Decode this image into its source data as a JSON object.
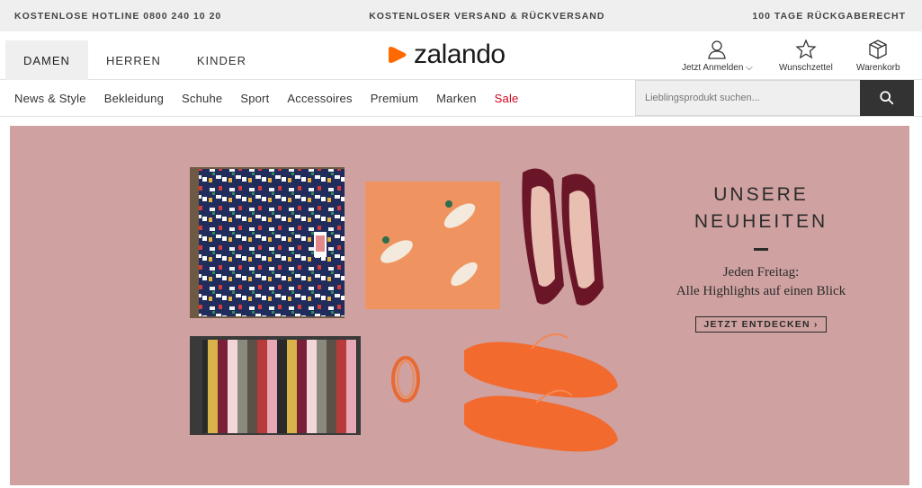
{
  "topbar": {
    "hotline": "KOSTENLOSE HOTLINE 0800 240 10 20",
    "shipping": "KOSTENLOSER VERSAND & RÜCKVERSAND",
    "returns": "100 TAGE RÜCKGABERECHT"
  },
  "header": {
    "tabs": [
      "DAMEN",
      "HERREN",
      "KINDER"
    ],
    "active_tab": "DAMEN",
    "logo": "zalando",
    "account": {
      "login": "Jetzt Anmelden",
      "wishlist": "Wunschzettel",
      "cart": "Warenkorb"
    }
  },
  "nav": {
    "items": [
      "News & Style",
      "Bekleidung",
      "Schuhe",
      "Sport",
      "Accessoires",
      "Premium",
      "Marken",
      "Sale"
    ]
  },
  "search": {
    "placeholder": "Lieblingsprodukt suchen..."
  },
  "hero": {
    "title_line1": "UNSERE",
    "title_line2": "NEUHEITEN",
    "subtitle_line1": "Jeden Freitag:",
    "subtitle_line2": "Alle Highlights auf einen Blick",
    "cta": "JETZT ENTDECKEN ›"
  },
  "colors": {
    "brand_orange": "#ff6900",
    "sale_red": "#d0021b",
    "hero_bg": "#cfa1a1",
    "search_button": "#333333"
  }
}
